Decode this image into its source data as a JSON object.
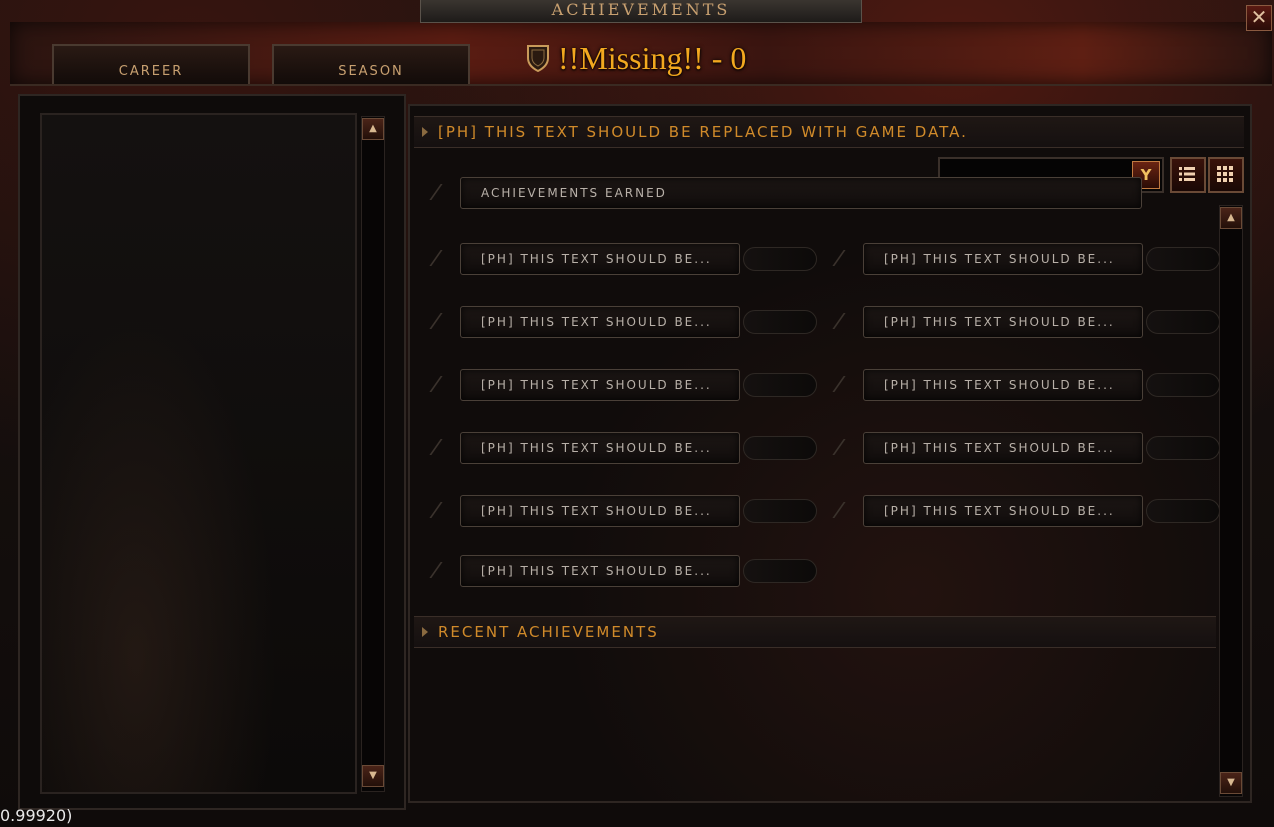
{
  "window": {
    "title": "ACHIEVEMENTS",
    "close_label": "✕"
  },
  "tabs": [
    {
      "label": "CAREER"
    },
    {
      "label": "SEASON"
    }
  ],
  "season": {
    "title": "!!Missing!! - 0"
  },
  "category_header": "[PH] THIS TEXT SHOULD BE REPLACED WITH GAME DATA.",
  "earned_label": "ACHIEVEMENTS EARNED",
  "achievement_items": [
    "[PH] THIS TEXT SHOULD BE...",
    "[PH] THIS TEXT SHOULD BE...",
    "[PH] THIS TEXT SHOULD BE...",
    "[PH] THIS TEXT SHOULD BE...",
    "[PH] THIS TEXT SHOULD BE...",
    "[PH] THIS TEXT SHOULD BE...",
    "[PH] THIS TEXT SHOULD BE...",
    "[PH] THIS TEXT SHOULD BE...",
    "[PH] THIS TEXT SHOULD BE...",
    "[PH] THIS TEXT SHOULD BE...",
    "[PH] THIS TEXT SHOULD BE..."
  ],
  "recent_header": "RECENT ACHIEVEMENTS",
  "filter": {
    "dropdown_icon": "chevron-down-icon",
    "list_view_icon": "list-icon",
    "grid_view_icon": "grid-icon"
  },
  "scroll": {
    "up": "▲",
    "down": "▼"
  },
  "status_text": "0.99920)",
  "colors": {
    "accent_gold": "#f2a81f",
    "header_orange": "#d08a2a",
    "dark_red": "#5a1c12"
  }
}
